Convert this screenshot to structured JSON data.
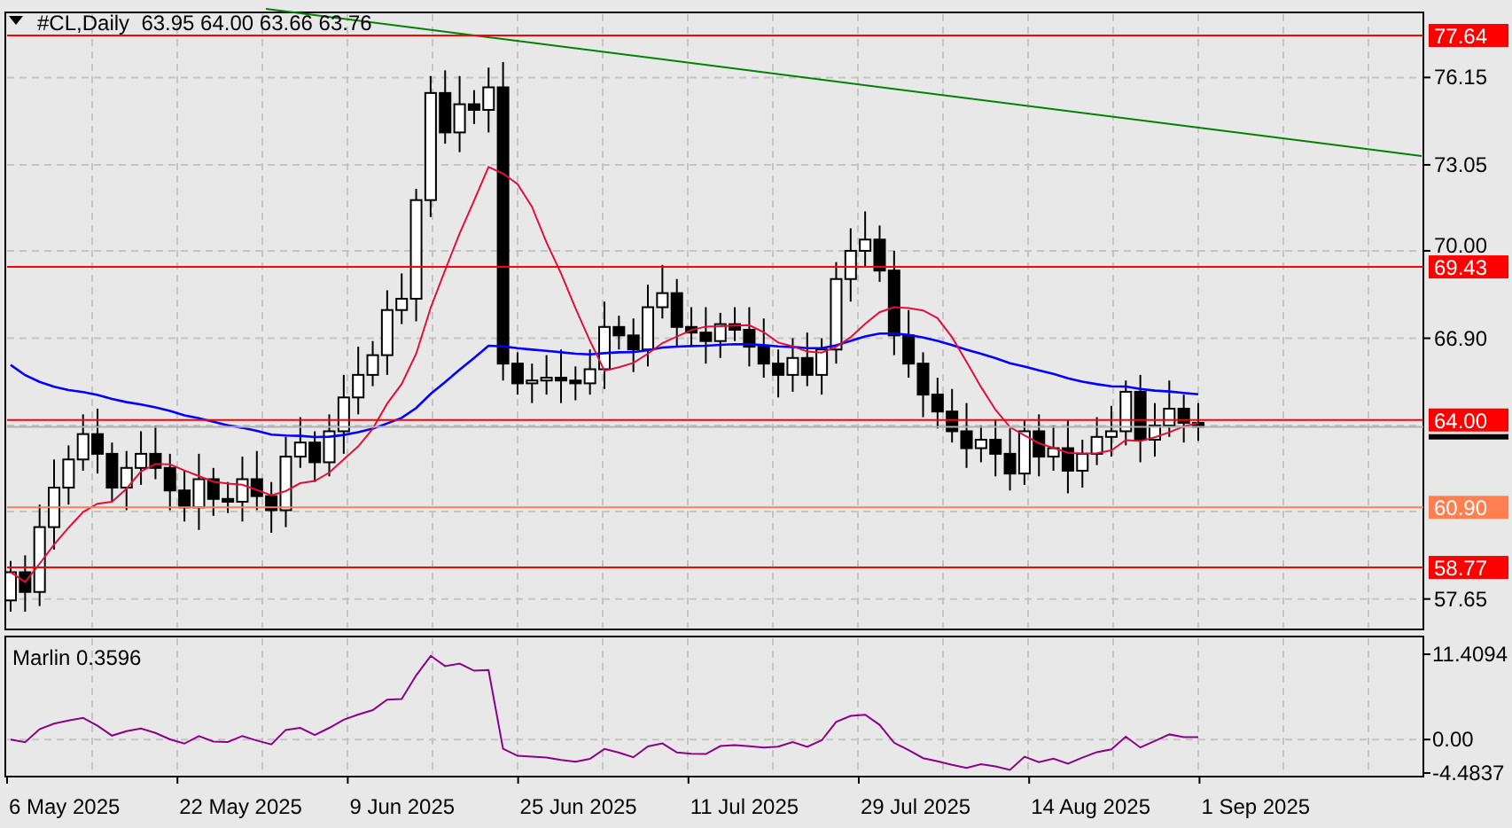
{
  "header": {
    "title": "#CL,Daily  63.95 64.00 63.66 63.76"
  },
  "price_axis": {
    "ticks": [
      "76.15",
      "73.05",
      "70.00",
      "66.90",
      "57.65"
    ]
  },
  "levels": [
    {
      "label": "77.64",
      "color": "#ff0000"
    },
    {
      "label": "69.43",
      "color": "#ff0000"
    },
    {
      "label": "64.00",
      "color": "#ff0000"
    },
    {
      "label": "60.90",
      "color": "#ff7f50"
    },
    {
      "label": "58.77",
      "color": "#ff0000"
    }
  ],
  "indicator": {
    "title": "Marlin 0.3596",
    "ticks": [
      "11.4094",
      "0.00",
      "-4.4837"
    ]
  },
  "time_axis": {
    "labels": [
      "6 May 2025",
      "22 May 2025",
      "9 Jun 2025",
      "25 Jun 2025",
      "11 Jul 2025",
      "29 Jul 2025",
      "14 Aug 2025",
      "1 Sep 2025"
    ]
  }
}
